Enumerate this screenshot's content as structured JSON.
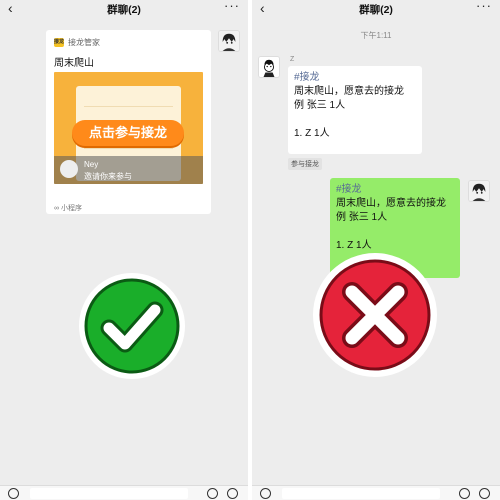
{
  "left_screen": {
    "title": "群聊(2)",
    "back_glyph": "‹",
    "more_glyph": "···",
    "card": {
      "source": "接龙管家",
      "logo_text": "接龙",
      "title": "周末爬山",
      "button": "点击参与接龙",
      "inviter_name": "Ney",
      "invite_text": "邀请你来参与",
      "footer": "小程序"
    },
    "overlay_icon": "check-mark-icon",
    "overlay_color": "#1aae2a"
  },
  "right_screen": {
    "title": "群聊(2)",
    "back_glyph": "‹",
    "more_glyph": "···",
    "time": "下午1:11",
    "sender_name": "Z",
    "incoming": {
      "tag": "#接龙",
      "line1": "周末爬山，愿意去的接龙",
      "line2": "例 张三 1人",
      "line3": "1. Z 1人"
    },
    "chip": "参与接龙",
    "outgoing": {
      "tag": "#接龙",
      "line1": "周末爬山，愿意去的接龙",
      "line2": "例 张三 1人",
      "line3": "1. Z 1人"
    },
    "overlay_icon": "cross-mark-icon",
    "overlay_color": "#e5233a"
  }
}
